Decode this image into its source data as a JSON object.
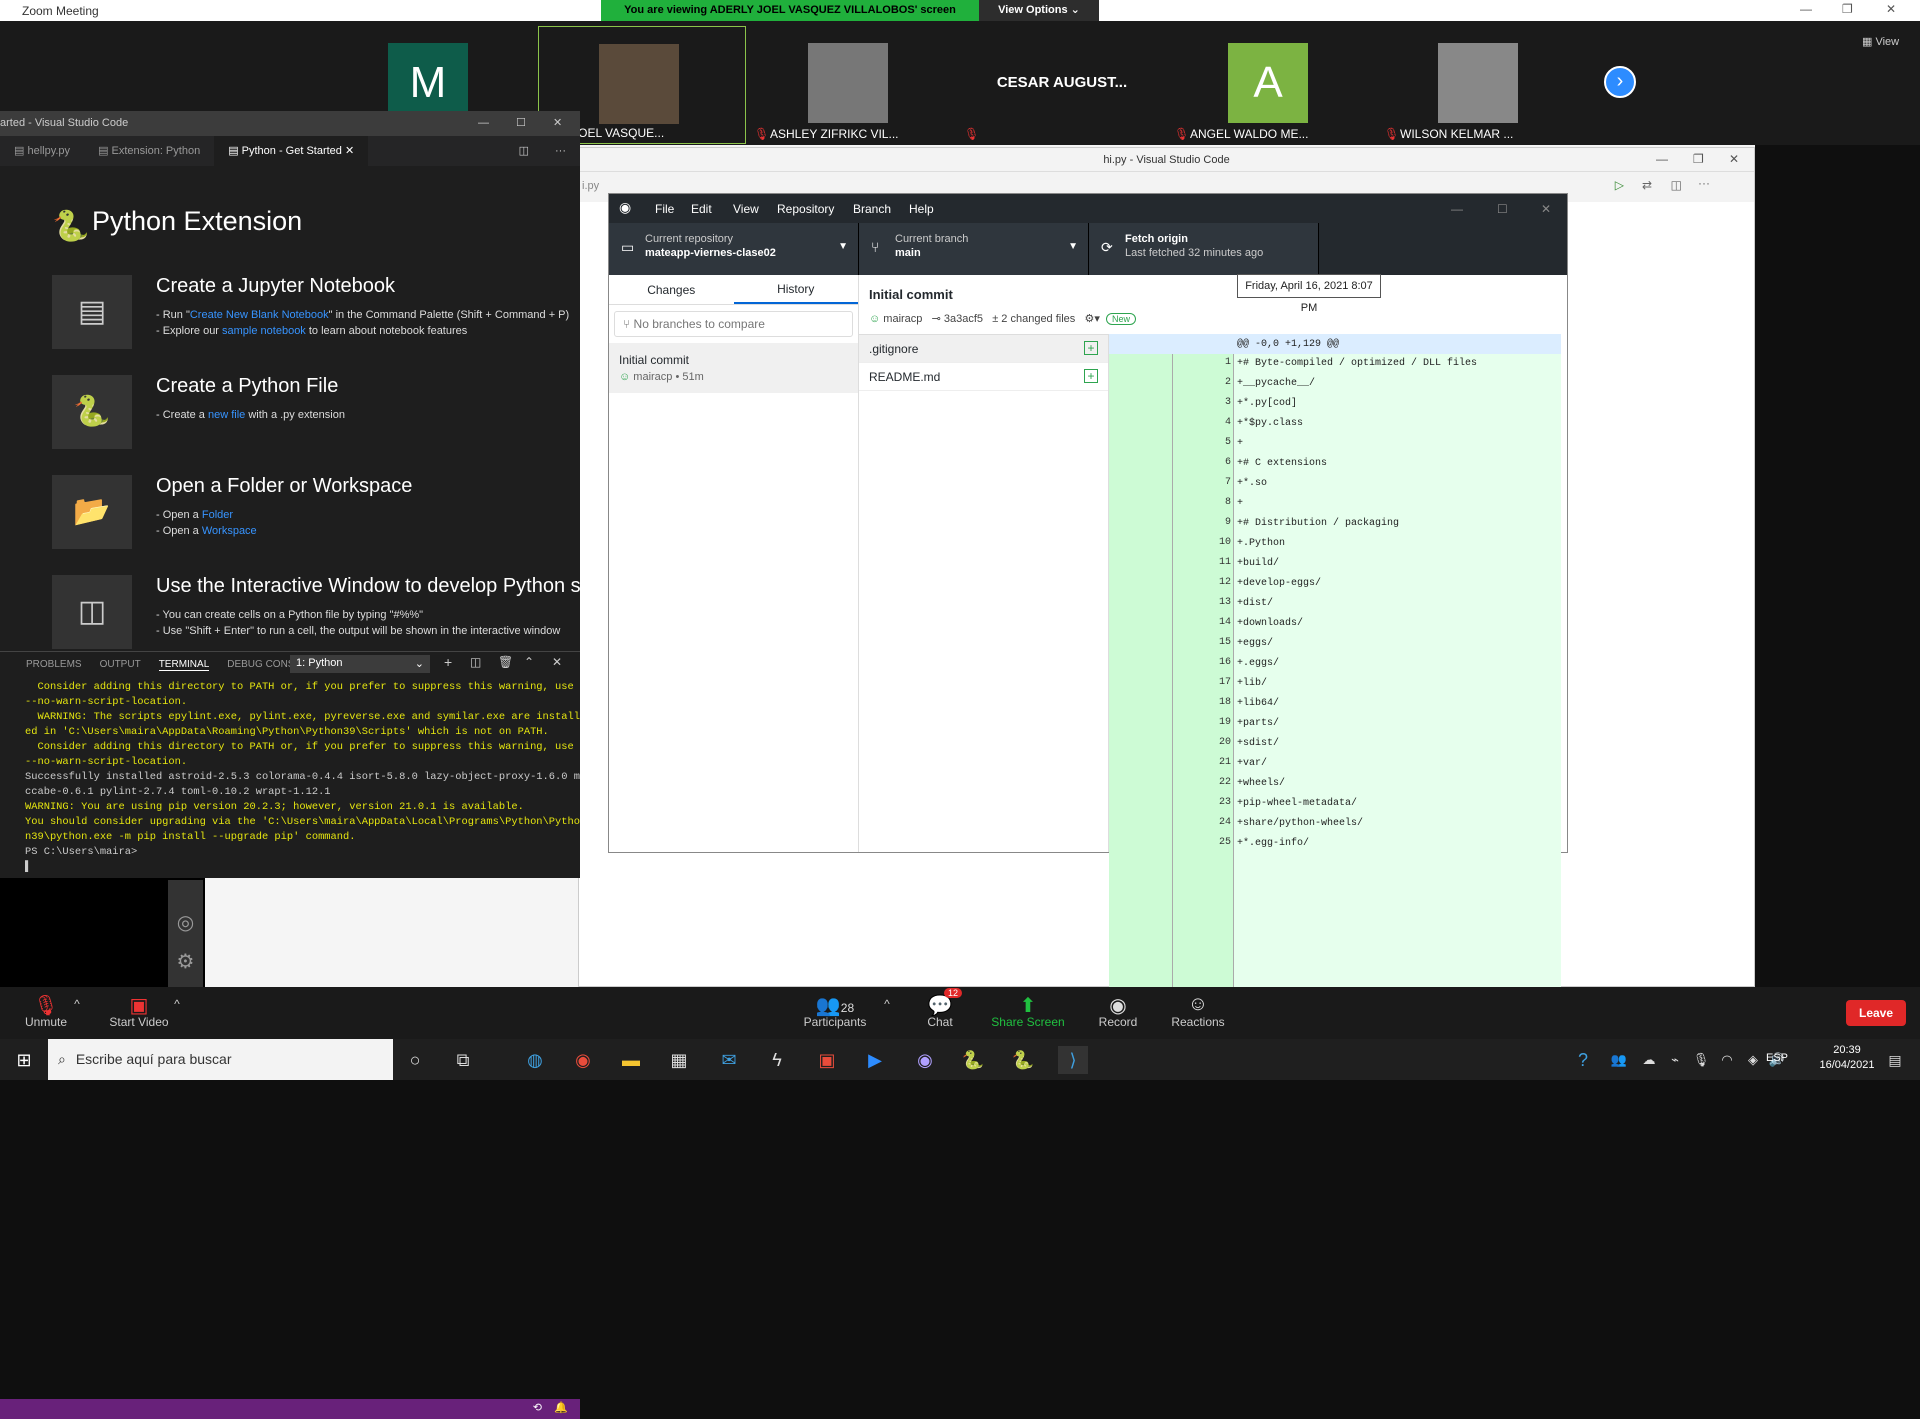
{
  "zoom": {
    "window_title": "Zoom Meeting",
    "viewing_banner": "You are viewing ADERLY JOEL VASQUEZ VILLALOBOS' screen",
    "view_options": "View Options",
    "view_label": "View",
    "participants": [
      {
        "initial": "M",
        "name": "",
        "color": "#0e5c4a",
        "muted": false
      },
      {
        "initial": "",
        "name": "Y JOEL VASQUE...",
        "color": "#5a4a3a",
        "muted": false
      },
      {
        "initial": "",
        "name": "ASHLEY ZIFRIKC VIL...",
        "color": "#777",
        "muted": true
      },
      {
        "initial": "",
        "name": "",
        "big_name": "CESAR AUGUST...",
        "color": "",
        "muted": true
      },
      {
        "initial": "A",
        "name": "ANGEL WALDO ME...",
        "color": "#7cb342",
        "muted": true
      },
      {
        "initial": "",
        "name": "WILSON KELMAR ...",
        "color": "#888",
        "muted": true
      }
    ],
    "toolbar": {
      "unmute": "Unmute",
      "start_video": "Start Video",
      "participants": "Participants",
      "participants_count": "28",
      "chat": "Chat",
      "chat_badge": "12",
      "share_screen": "Share Screen",
      "record": "Record",
      "reactions": "Reactions",
      "leave": "Leave"
    }
  },
  "vscode_right": {
    "title": "hi.py - Visual Studio Code",
    "tab_fragment": "i.py"
  },
  "vscode_left": {
    "title": "arted - Visual Studio Code",
    "tabs": [
      "hellpy.py",
      "Extension: Python",
      "Python - Get Started"
    ],
    "heading": "Python Extension",
    "items": [
      {
        "title": "Create a Jupyter Notebook",
        "l1a": "- Run \"",
        "l1link": "Create New Blank Notebook",
        "l1b": "\" in the Command Palette (Shift + Command + P)",
        "l2a": "- Explore our ",
        "l2link": "sample notebook",
        "l2b": " to learn about notebook features"
      },
      {
        "title": "Create a Python File",
        "l1a": "- Create a ",
        "l1link": "new file",
        "l1b": " with a .py extension",
        "l2a": "",
        "l2link": "",
        "l2b": ""
      },
      {
        "title": "Open a Folder or Workspace",
        "l1a": "- Open a ",
        "l1link": "Folder",
        "l1b": "",
        "l2a": "- Open a ",
        "l2link": "Workspace",
        "l2b": ""
      },
      {
        "title": "Use the Interactive Window to develop Python s",
        "l1a": "- You can create cells on a Python file by typing \"#%%\"",
        "l1link": "",
        "l1b": "",
        "l2a": "- Use \"Shift + Enter\" to run a cell, the output will be shown in the interactive window",
        "l2link": "",
        "l2b": ""
      }
    ],
    "panel_tabs": [
      "PROBLEMS",
      "OUTPUT",
      "TERMINAL",
      "DEBUG CONSOLE"
    ],
    "terminal_select": "1: Python",
    "terminal_lines": [
      "  Consider adding this directory to PATH or, if you prefer to suppress this warning, use",
      "--no-warn-script-location.",
      "  WARNING: The scripts epylint.exe, pylint.exe, pyreverse.exe and symilar.exe are install",
      "ed in 'C:\\Users\\maira\\AppData\\Roaming\\Python\\Python39\\Scripts' which is not on PATH.",
      "  Consider adding this directory to PATH or, if you prefer to suppress this warning, use",
      "--no-warn-script-location.",
      "Successfully installed astroid-2.5.3 colorama-0.4.4 isort-5.8.0 lazy-object-proxy-1.6.0 m",
      "ccabe-0.6.1 pylint-2.7.4 toml-0.10.2 wrapt-1.12.1",
      "WARNING: You are using pip version 20.2.3; however, version 21.0.1 is available.",
      "You should consider upgrading via the 'C:\\Users\\maira\\AppData\\Local\\Programs\\Python\\Pytho",
      "n39\\python.exe -m pip install --upgrade pip' command.",
      "PS C:\\Users\\maira> "
    ]
  },
  "github": {
    "menu": [
      "File",
      "Edit",
      "View",
      "Repository",
      "Branch",
      "Help"
    ],
    "repo_label": "Current repository",
    "repo_name": "mateapp-viernes-clase02",
    "branch_label": "Current branch",
    "branch_name": "main",
    "fetch_label": "Fetch origin",
    "fetch_sub": "Last fetched 32 minutes ago",
    "tabs": [
      "Changes",
      "History"
    ],
    "branch_compare_placeholder": "No branches to compare",
    "commit_title": "Initial commit",
    "commit_meta": "mairacp • 51m",
    "detail_title": "Initial commit",
    "author": "mairacp",
    "sha": "3a3acf5",
    "changed_files": "2 changed files",
    "new_badge": "New",
    "tooltip": "Friday, April 16, 2021 8:07 PM",
    "files": [
      ".gitignore",
      "README.md"
    ],
    "hunk": "@@ -0,0 +1,129 @@",
    "diff_lines": [
      "+# Byte-compiled / optimized / DLL files",
      "+__pycache__/",
      "+*.py[cod]",
      "+*$py.class",
      "+",
      "+# C extensions",
      "+*.so",
      "+",
      "+# Distribution / packaging",
      "+.Python",
      "+build/",
      "+develop-eggs/",
      "+dist/",
      "+downloads/",
      "+eggs/",
      "+.eggs/",
      "+lib/",
      "+lib64/",
      "+parts/",
      "+sdist/",
      "+var/",
      "+wheels/",
      "+pip-wheel-metadata/",
      "+share/python-wheels/",
      "+*.egg-info/"
    ]
  },
  "taskbar": {
    "search_placeholder": "Escribe aquí para buscar",
    "lang": "ESP",
    "time": "20:39",
    "date": "16/04/2021"
  }
}
